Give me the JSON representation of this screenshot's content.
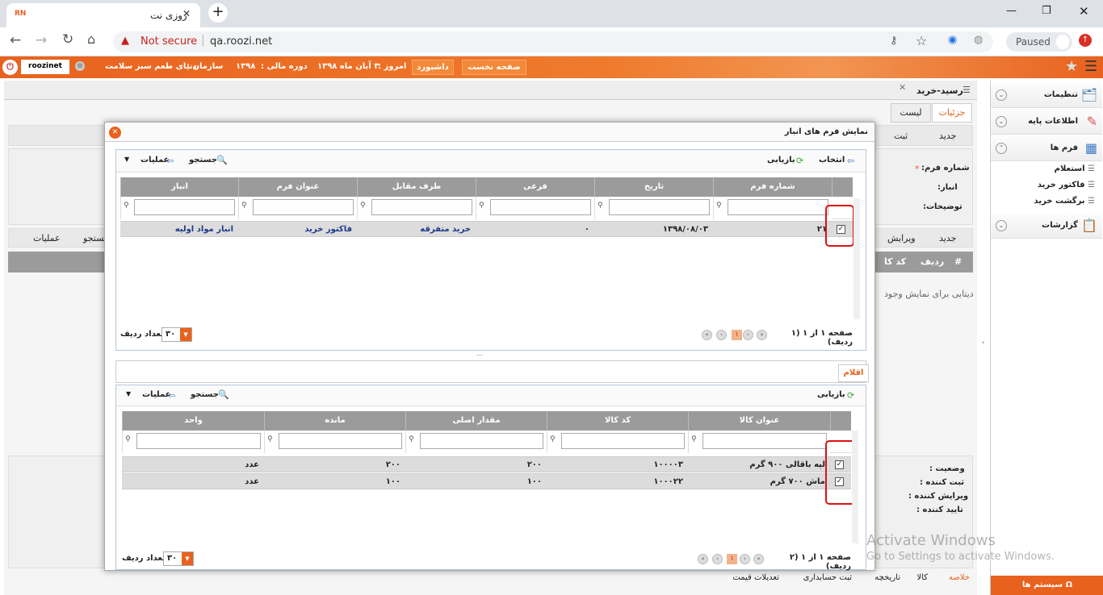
{
  "browser": {
    "tab_title": "روزی نت",
    "favicon_text": "RN",
    "new_tab": "+",
    "security": "Not secure",
    "url": "qa.roozi.net",
    "paused": "Paused",
    "win_min": "—",
    "win_max": "❐",
    "win_close": "✕",
    "tab_close": "✕"
  },
  "header": {
    "user": "roozinet",
    "org_label": "سازمان :",
    "org": "دنیای طعم سبز سلامت",
    "fiscal_label": "دوره مالی :",
    "fiscal": "۱۳۹۸",
    "today_label": "امروز :",
    "today": "۳ آبان ماه ۱۳۹۸",
    "dashboard": "داشبورد",
    "home": "صفحه نخست"
  },
  "sidebar": {
    "items": [
      {
        "label": "تنظیمات",
        "toggle": "⌄"
      },
      {
        "label": "اطلاعات پایه",
        "toggle": "⌄"
      },
      {
        "label": "فرم ها",
        "toggle": "⌃"
      }
    ],
    "sub_items": [
      "استعلام",
      "فاکتور خرید",
      "برگشت خرید"
    ],
    "reports": "گزارشات",
    "system": "سیستم ها",
    "system_icon": "Ω"
  },
  "page": {
    "tab_title": "رسید-خرید",
    "tabs": [
      "جزئیات",
      "لیست"
    ],
    "new": "جدید",
    "save": "ثبت",
    "new2": "جدید",
    "edit": "ویرایش",
    "search": "جستجو",
    "ops": "عملیات",
    "form_no": "شماره فرم:",
    "warehouse": "انبار:",
    "desc": "توضیحات:",
    "required_mark": "*",
    "grid_cols": [
      "#",
      "ردیف",
      "کد کا"
    ],
    "empty": "دیتایی برای نمایش وجود",
    "status": "وضعیت :",
    "creator": "ثبت کننده :",
    "editor": "ویرایش کننده :",
    "approver": "تایید کننده :",
    "bottom_tabs": [
      "خلاصه",
      "کالا",
      "تاریخچه",
      "ثبت حسابداری",
      "تعدیلات قیمت"
    ]
  },
  "modal": {
    "title": "نمایش فرم های انبار",
    "top": {
      "select": "انتخاب",
      "refresh": "بازیابی",
      "search": "جستجو",
      "ops": "عملیات",
      "columns": [
        "شماره فرم",
        "تاریخ",
        "فرعی",
        "طرف مقابل",
        "عنوان فرم",
        "انبار"
      ],
      "rows": [
        {
          "checked": "✓",
          "cells": [
            "۲۱",
            "۱۳۹۸/۰۸/۰۳",
            "۰",
            "خرید متفرقه",
            "فاکتور خرید",
            "انبار مواد اولیه"
          ]
        }
      ],
      "pager": "صفحه ۱ از ۱ (۱ ردیف)",
      "page": "۱",
      "rowcount_label": "تعداد ردیف",
      "rowcount": "۳۰"
    },
    "items_tab": "اقلام",
    "bottom": {
      "refresh": "بازیابی",
      "search": "جستجو",
      "ops": "عملیات",
      "columns": [
        "عنوان کالا",
        "کد کالا",
        "مقدار اصلی",
        "مانده",
        "واحد"
      ],
      "rows": [
        {
          "checked": "✓",
          "cells": [
            "لپه باقالی ۹۰۰ گرم",
            "۱۰۰۰۰۳",
            "۲۰۰",
            "۲۰۰",
            "عدد"
          ]
        },
        {
          "checked": "✓",
          "cells": [
            "ماش ۷۰۰ گرم",
            "۱۰۰۰۲۲",
            "۱۰۰",
            "۱۰۰",
            "عدد"
          ]
        }
      ],
      "pager": "صفحه ۱ از ۱ (۲ ردیف)",
      "page": "۱",
      "rowcount_label": "تعداد ردیف",
      "rowcount": "۳۰"
    }
  },
  "watermark": {
    "line1": "Activate Windows",
    "line2": "Go to Settings to activate Windows."
  },
  "colors": {
    "accent": "#e8621e",
    "grid_header": "#9b9b9b",
    "selected": "#dcdcdc",
    "highlight": "#d11111"
  }
}
